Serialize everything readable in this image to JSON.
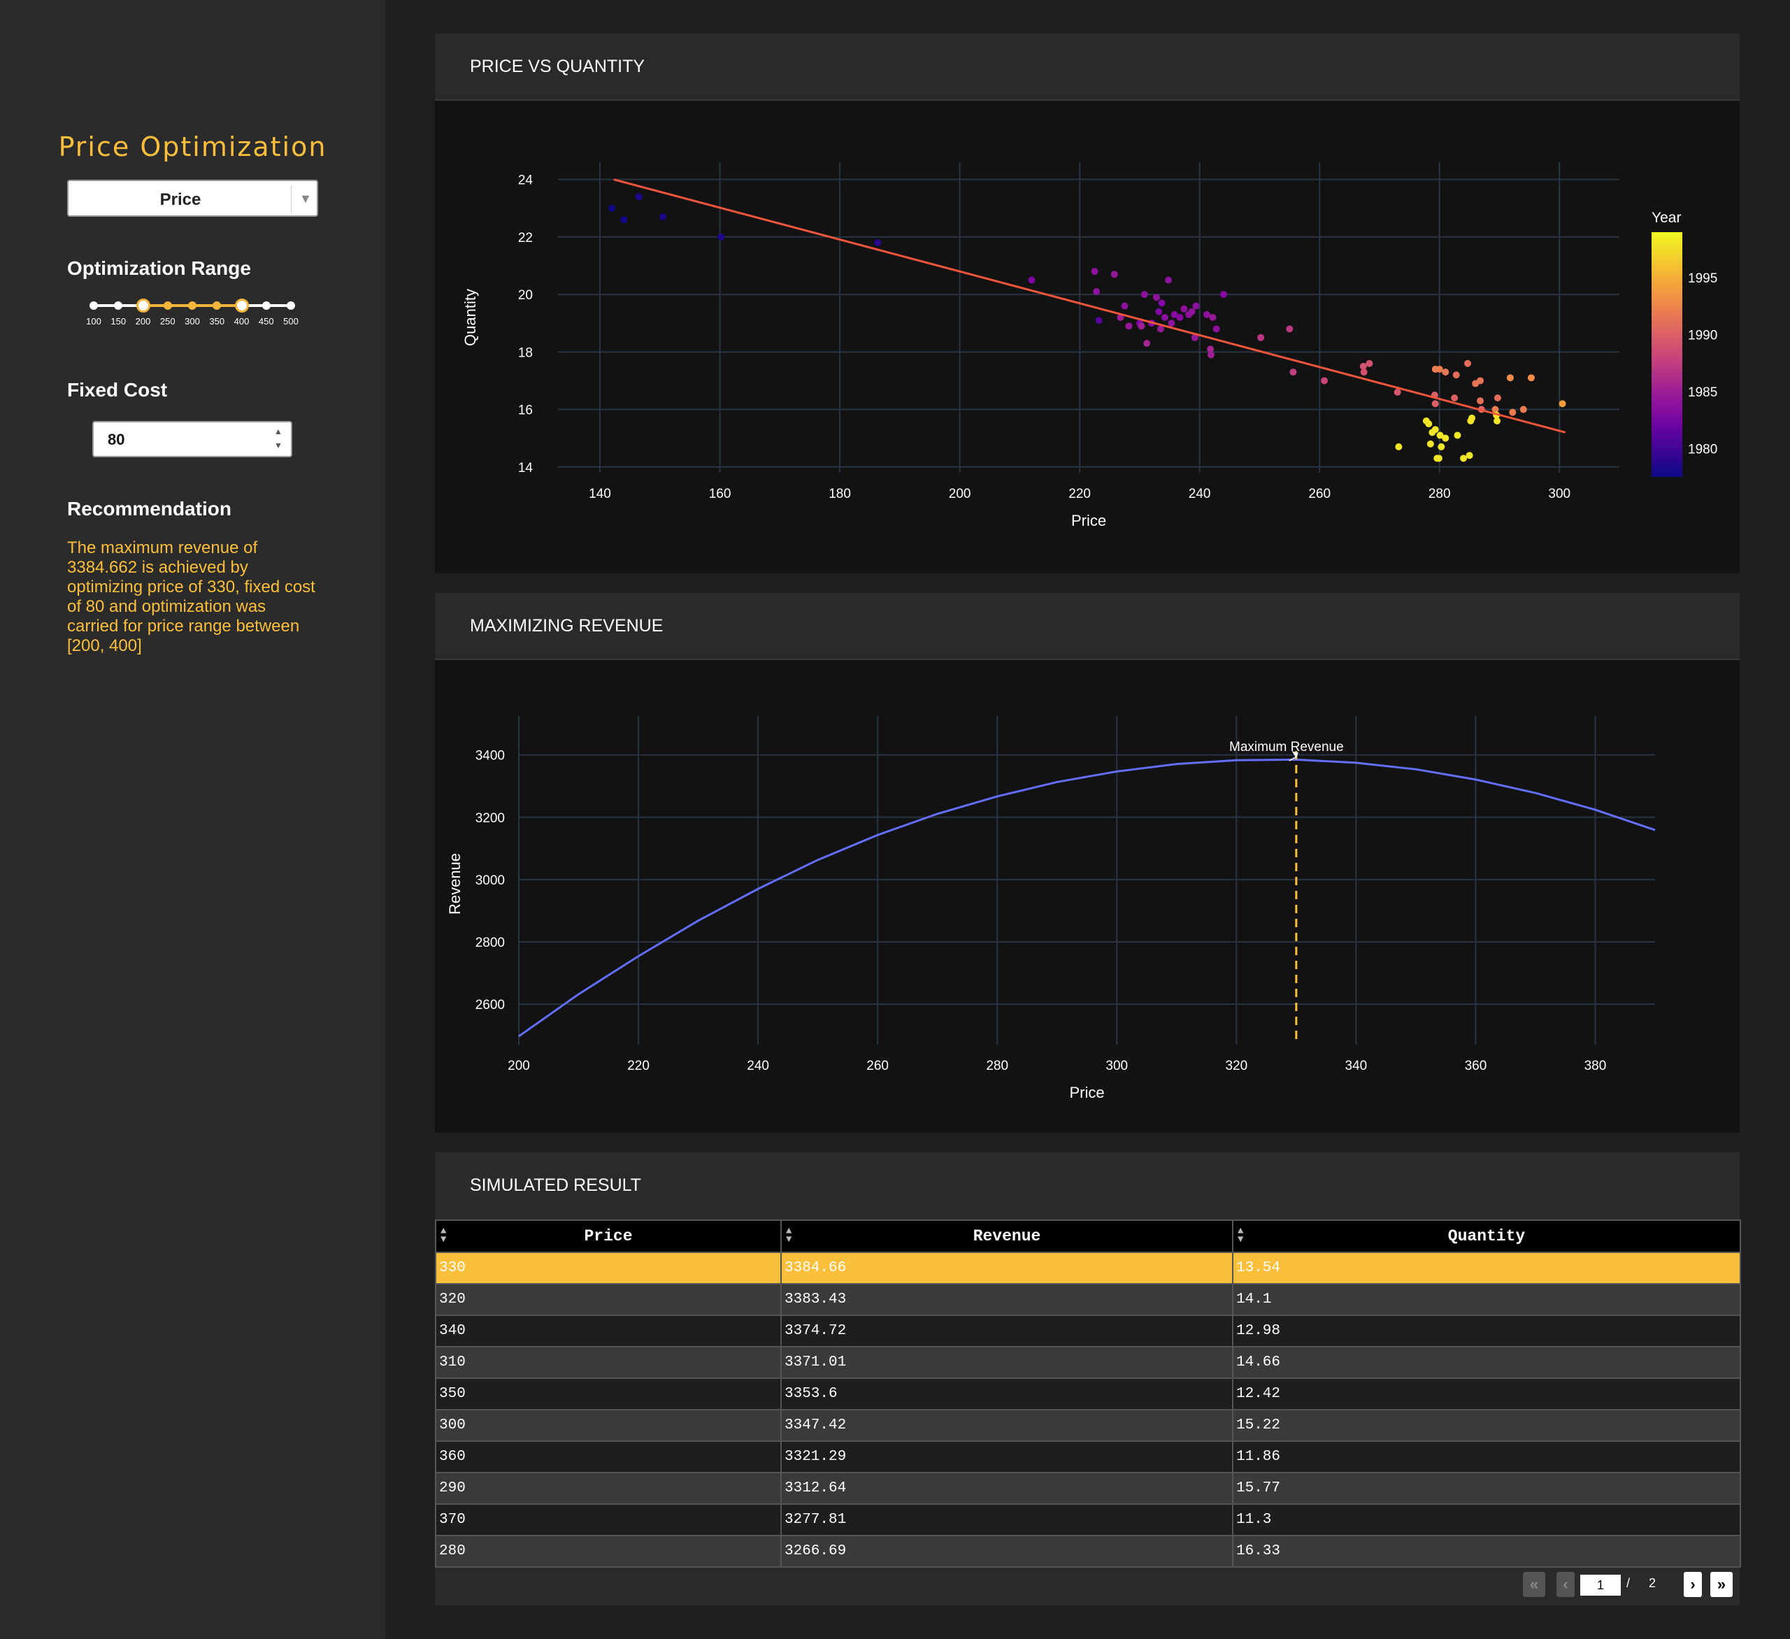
{
  "sidebar": {
    "title": "Price Optimization",
    "dropdown_value": "Price",
    "range_heading": "Optimization Range",
    "range_marks": [
      "100",
      "150",
      "200",
      "250",
      "300",
      "350",
      "400",
      "450",
      "500"
    ],
    "range_selected": [
      200,
      400
    ],
    "fixed_cost_heading": "Fixed Cost",
    "fixed_cost_value": "80",
    "recommendation_heading": "Recommendation",
    "recommendation_text": "The maximum revenue of 3384.662 is achieved by optimizing price of 330, fixed cost of 80 and optimization was carried for price range between [200, 400]"
  },
  "colors": {
    "accent": "#fbbf3c",
    "line": "#636efa",
    "fit": "#ef553b"
  },
  "panels": {
    "scatter_title": "PRICE VS QUANTITY",
    "revenue_title": "MAXIMIZING REVENUE",
    "table_title": "SIMULATED RESULT"
  },
  "chart_data": [
    {
      "type": "scatter",
      "xlabel": "Price",
      "ylabel": "Quantity",
      "xlim": [
        133,
        310
      ],
      "ylim": [
        13.8,
        24.6
      ],
      "xticks": [
        140,
        160,
        180,
        200,
        220,
        240,
        260,
        280,
        300
      ],
      "yticks": [
        14,
        16,
        18,
        20,
        22,
        24
      ],
      "colorbar": {
        "title": "Year",
        "ticks": [
          1980,
          1985,
          1990,
          1995
        ],
        "range": [
          1977.5,
          1999
        ]
      },
      "fit_line": [
        [
          142.3,
          24.0
        ],
        [
          301,
          15.2
        ]
      ],
      "points": [
        [
          142,
          23.0,
          1977.6
        ],
        [
          144,
          22.6,
          1977.8
        ],
        [
          146.5,
          23.4,
          1978
        ],
        [
          150.5,
          22.7,
          1978.2
        ],
        [
          160.2,
          22.0,
          1978.5
        ],
        [
          186.3,
          21.8,
          1978.8
        ],
        [
          212,
          20.5,
          1983
        ],
        [
          222.5,
          20.8,
          1984
        ],
        [
          222.8,
          20.1,
          1984
        ],
        [
          223.2,
          19.1,
          1981
        ],
        [
          225.8,
          20.7,
          1984.5
        ],
        [
          226.8,
          19.2,
          1985
        ],
        [
          227.5,
          19.6,
          1984
        ],
        [
          228.2,
          18.9,
          1984.5
        ],
        [
          230,
          19.0,
          1983
        ],
        [
          230.3,
          18.9,
          1985
        ],
        [
          230.8,
          20.0,
          1984
        ],
        [
          231.2,
          18.3,
          1985.5
        ],
        [
          232,
          19.0,
          1983.5
        ],
        [
          232.8,
          19.9,
          1984
        ],
        [
          233.2,
          19.4,
          1983
        ],
        [
          233.5,
          18.8,
          1984.5
        ],
        [
          233.7,
          19.7,
          1983.2
        ],
        [
          234.2,
          19.2,
          1983.8
        ],
        [
          234.8,
          20.5,
          1984
        ],
        [
          235.3,
          19.0,
          1984.2
        ],
        [
          235.8,
          19.3,
          1983.5
        ],
        [
          236.7,
          19.2,
          1983.5
        ],
        [
          237.4,
          19.5,
          1984
        ],
        [
          238.2,
          19.3,
          1984
        ],
        [
          238.7,
          19.4,
          1984.2
        ],
        [
          239.2,
          18.5,
          1984.5
        ],
        [
          239.4,
          19.6,
          1983.8
        ],
        [
          241.2,
          19.3,
          1984
        ],
        [
          241.8,
          18.1,
          1985.5
        ],
        [
          241.9,
          17.9,
          1985
        ],
        [
          242.2,
          19.2,
          1984.5
        ],
        [
          242.8,
          18.8,
          1984
        ],
        [
          244,
          20.0,
          1983.5
        ],
        [
          250.2,
          18.5,
          1987
        ],
        [
          255,
          18.8,
          1987
        ],
        [
          255.6,
          17.3,
          1987.5
        ],
        [
          260.8,
          17.0,
          1988
        ],
        [
          267.3,
          17.5,
          1989
        ],
        [
          267.4,
          17.3,
          1989
        ],
        [
          268.3,
          17.6,
          1989
        ],
        [
          273,
          16.6,
          1989.5
        ],
        [
          279.3,
          16.2,
          1990
        ],
        [
          279.2,
          16.5,
          1990
        ],
        [
          279.3,
          17.4,
          1992
        ],
        [
          280,
          17.4,
          1992
        ],
        [
          281,
          17.3,
          1991.5
        ],
        [
          282.5,
          16.4,
          1990
        ],
        [
          282.8,
          17.2,
          1991
        ],
        [
          284.7,
          17.6,
          1991
        ],
        [
          286,
          16.9,
          1991.5
        ],
        [
          286.8,
          17.0,
          1991.5
        ],
        [
          286.8,
          16.3,
          1991
        ],
        [
          287,
          16.0,
          1990.5
        ],
        [
          289.3,
          16.0,
          1992
        ],
        [
          289.7,
          16.4,
          1991
        ],
        [
          291.8,
          17.1,
          1993
        ],
        [
          292.2,
          15.9,
          1992
        ],
        [
          294,
          16.0,
          1992
        ],
        [
          295.3,
          17.1,
          1993
        ],
        [
          300.5,
          16.2,
          1994
        ],
        [
          273.2,
          14.7,
          1998
        ],
        [
          277.8,
          15.6,
          1998
        ],
        [
          278.2,
          15.5,
          1998
        ],
        [
          278.5,
          14.8,
          1998
        ],
        [
          278.8,
          15.2,
          1998
        ],
        [
          279.3,
          15.3,
          1998
        ],
        [
          279.6,
          14.3,
          1998
        ],
        [
          279.9,
          14.3,
          1998
        ],
        [
          280.1,
          15.1,
          1998
        ],
        [
          280.3,
          14.7,
          1998
        ],
        [
          281,
          15.0,
          1998
        ],
        [
          283,
          15.1,
          1998
        ],
        [
          284,
          14.3,
          1998
        ],
        [
          285,
          14.4,
          1998
        ],
        [
          285.2,
          15.6,
          1998
        ],
        [
          285.4,
          15.7,
          1998
        ],
        [
          289.5,
          15.8,
          1998
        ],
        [
          289.6,
          15.6,
          1998
        ]
      ]
    },
    {
      "type": "line",
      "xlabel": "Price",
      "ylabel": "Revenue",
      "xlim": [
        200,
        390
      ],
      "ylim": [
        2470,
        3525
      ],
      "xticks": [
        200,
        220,
        240,
        260,
        280,
        300,
        320,
        340,
        360,
        380
      ],
      "yticks": [
        2600,
        2800,
        3000,
        3200,
        3400
      ],
      "x": [
        200,
        210,
        220,
        230,
        240,
        250,
        260,
        270,
        280,
        290,
        300,
        310,
        320,
        330,
        340,
        350,
        360,
        370,
        380,
        390
      ],
      "y": [
        2497,
        2632,
        2754,
        2868,
        2970,
        3063,
        3143,
        3211,
        3267,
        3313,
        3347,
        3371,
        3383,
        3385,
        3375,
        3354,
        3321,
        3278,
        3224,
        3159
      ],
      "vline_x": 330,
      "annotation": {
        "text": "Maximum Revenue",
        "x": 330,
        "y": 3385
      }
    },
    {
      "type": "table",
      "columns": [
        "Price",
        "Revenue",
        "Quantity"
      ],
      "rows": [
        [
          "330",
          "3384.66",
          "13.54"
        ],
        [
          "320",
          "3383.43",
          "14.1"
        ],
        [
          "340",
          "3374.72",
          "12.98"
        ],
        [
          "310",
          "3371.01",
          "14.66"
        ],
        [
          "350",
          "3353.6",
          "12.42"
        ],
        [
          "300",
          "3347.42",
          "15.22"
        ],
        [
          "360",
          "3321.29",
          "11.86"
        ],
        [
          "290",
          "3312.64",
          "15.77"
        ],
        [
          "370",
          "3277.81",
          "11.3"
        ],
        [
          "280",
          "3266.69",
          "16.33"
        ]
      ],
      "highlight_row": 0
    }
  ],
  "pagination": {
    "first": "«",
    "prev": "‹",
    "current": "1",
    "separator": "/",
    "total": "2",
    "next": "›",
    "last": "»"
  }
}
